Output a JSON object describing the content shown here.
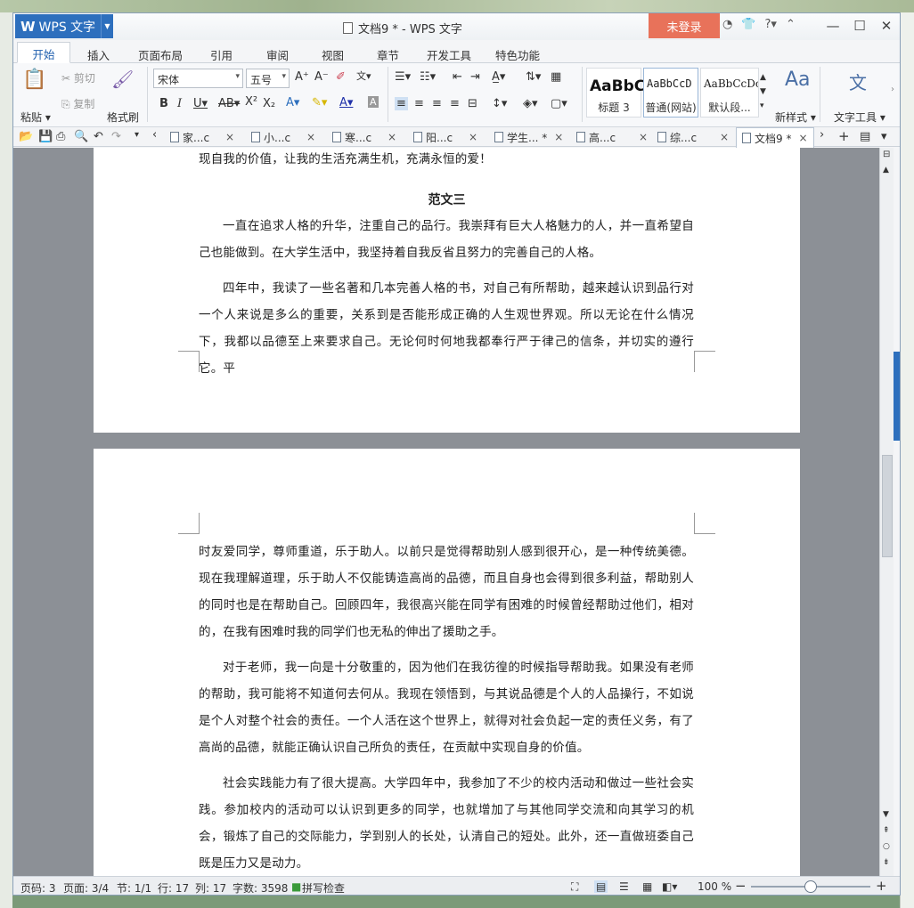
{
  "app": {
    "logo_label": "WPS 文字",
    "window_title": "文档9 * - WPS 文字",
    "login_label": "未登录"
  },
  "title_icons": {
    "skin": "tshirt-icon",
    "help": "?",
    "collapse": "⌃"
  },
  "menu": {
    "tabs": [
      "开始",
      "插入",
      "页面布局",
      "引用",
      "审阅",
      "视图",
      "章节",
      "开发工具",
      "特色功能"
    ],
    "active": "开始"
  },
  "ribbon": {
    "paste": "粘贴",
    "cut": "剪切",
    "copy": "复制",
    "format_painter": "格式刷",
    "font_name": "宋体",
    "font_size": "五号",
    "styles": [
      {
        "preview": "AaBbC",
        "label": "标题 3"
      },
      {
        "preview": "AaBbCcD",
        "label": "普通(网站)"
      },
      {
        "preview": "AaBbCcDc",
        "label": "默认段..."
      }
    ],
    "new_style": "新样式",
    "text_tools": "文字工具"
  },
  "doc_tabs": [
    {
      "label": "家...c"
    },
    {
      "label": "小...c"
    },
    {
      "label": "寒...c"
    },
    {
      "label": "阳...c"
    },
    {
      "label": "学生... *"
    },
    {
      "label": "高...c"
    },
    {
      "label": "综...c"
    },
    {
      "label": "文档9 *"
    }
  ],
  "document": {
    "cut_line": "现自我的价值，让我的生活充满生机，充满永恒的爱！",
    "heading": "范文三",
    "page1_paragraphs": [
      "一直在追求人格的升华，注重自己的品行。我崇拜有巨大人格魅力的人，并一直希望自己也能做到。在大学生活中，我坚持着自我反省且努力的完善自己的人格。",
      "四年中，我读了一些名著和几本完善人格的书，对自己有所帮助，越来越认识到品行对一个人来说是多么的重要，关系到是否能形成正确的人生观世界观。所以无论在什么情况下，我都以品德至上来要求自己。无论何时何地我都奉行严于律己的信条，并切实的遵行它。平"
    ],
    "page2_paragraphs": [
      "时友爱同学，尊师重道，乐于助人。以前只是觉得帮助别人感到很开心，是一种传统美德。现在我理解道理，乐于助人不仅能铸造高尚的品德，而且自身也会得到很多利益，帮助别人的同时也是在帮助自己。回顾四年，我很高兴能在同学有困难的时候曾经帮助过他们，相对的，在我有困难时我的同学们也无私的伸出了援助之手。",
      "对于老师，我一向是十分敬重的，因为他们在我彷徨的时候指导帮助我。如果没有老师的帮助，我可能将不知道何去何从。我现在领悟到，与其说品德是个人的人品操行，不如说是个人对整个社会的责任。一个人活在这个世界上，就得对社会负起一定的责任义务，有了高尚的品德，就能正确认识自己所负的责任，在贡献中实现自身的价值。",
      "社会实践能力有了很大提高。大学四年中，我参加了不少的校内活动和做过一些社会实践。参加校内的活动可以认识到更多的同学，也就增加了与其他同学交流和向其学习的机会，锻炼了自己的交际能力，学到别人的长处，认清自己的短处。此外，还一直做班委自己既是压力又是动力。"
    ]
  },
  "status": {
    "page_num": "页码: 3",
    "pages": "页面: 3/4",
    "section": "节: 1/1",
    "row": "行: 17",
    "col": "列: 17",
    "words": "字数: 3598",
    "spell": "拼写检查",
    "zoom": "100 %",
    "zoom_level": 0.5
  },
  "colors": {
    "accent": "#2d6fbd",
    "login": "#e8725a",
    "doc_bg": "#8c9096"
  }
}
